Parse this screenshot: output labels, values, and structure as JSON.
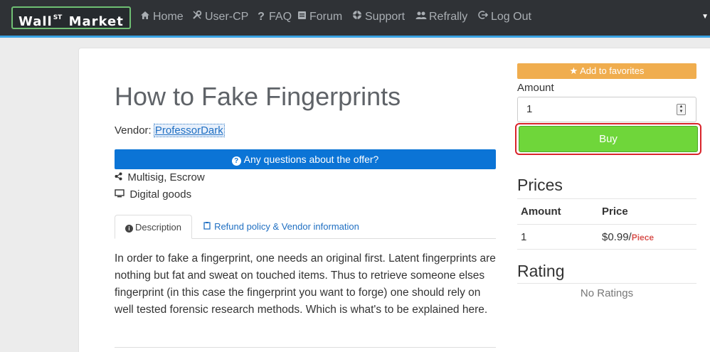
{
  "brand": {
    "name_pre": "Wall",
    "name_sup": "ST",
    "name_post": "Market"
  },
  "nav": [
    {
      "icon": "home-icon",
      "label": "Home"
    },
    {
      "icon": "wrench-icon",
      "label": "User-CP"
    },
    {
      "icon": "question-icon",
      "label": "FAQ"
    },
    {
      "icon": "forum-icon",
      "label": "Forum"
    },
    {
      "icon": "support-icon",
      "label": "Support"
    },
    {
      "icon": "users-icon",
      "label": "Refrally"
    },
    {
      "icon": "logout-icon",
      "label": "Log Out"
    }
  ],
  "product": {
    "title": "How to Fake Fingerprints",
    "vendor_label": "Vendor:",
    "vendor_name": "ProfessorDark",
    "questions_button": "Any questions about the offer?",
    "payment": "Multisig, Escrow",
    "category": "Digital goods"
  },
  "tabs": [
    {
      "label": "Description",
      "icon": "info-icon",
      "active": true
    },
    {
      "label": "Refund policy & Vendor information",
      "icon": "clipboard-icon",
      "active": false
    }
  ],
  "description": "In order to fake a fingerprint, one needs an original first. Latent fingerprints are nothing but fat and sweat on touched items. Thus to retrieve someone elses fingerprint (in this case the fingerprint you want to forge) one should rely on well tested forensic research methods. Which is what's to be explained here.",
  "sidebar": {
    "favorites_button": "★ Add to favorites",
    "amount_label": "Amount",
    "amount_value": "1",
    "buy_button": "Buy",
    "prices_heading": "Prices",
    "prices_columns": [
      "Amount",
      "Price"
    ],
    "prices_rows": [
      {
        "amount": "1",
        "price": "$0.99/",
        "unit": "Piece"
      }
    ],
    "rating_heading": "Rating",
    "rating_text": "No Ratings"
  },
  "colors": {
    "navbar": "#2f3236",
    "accent": "#3aa3e3",
    "primary_button": "#0b74d6",
    "favorites": "#f0ad4e",
    "buy": "#6fd63a",
    "highlight_border": "#d9242b"
  }
}
